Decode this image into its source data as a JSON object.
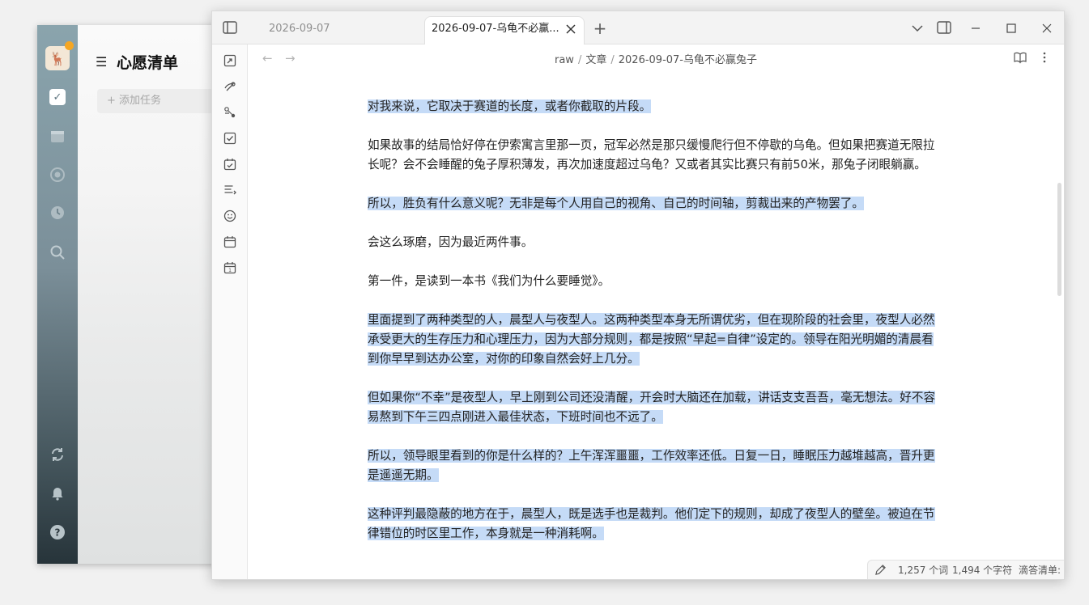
{
  "background_app": {
    "title": "心愿清单",
    "add_task_placeholder": "添加任务",
    "icons": [
      "avatar-icon",
      "task-check-icon",
      "calendar-icon",
      "focus-icon",
      "clock-icon",
      "search-icon",
      "sync-icon",
      "bell-icon",
      "help-icon"
    ]
  },
  "window": {
    "tabs": [
      {
        "label": "2026-09-07",
        "active": false
      },
      {
        "label": "2026-09-07-乌龟不必赢...",
        "active": true,
        "pinned": true
      }
    ],
    "new_tab_label": "+"
  },
  "breadcrumb": {
    "parts": [
      "raw",
      "文章",
      "2026-09-07-乌龟不必赢兔子"
    ],
    "separator": "/"
  },
  "document": {
    "paragraphs": [
      {
        "text": "对我来说，它取决于赛道的长度，或者你截取的片段。",
        "highlighted": true
      },
      {
        "text": "如果故事的结局恰好停在伊索寓言里那一页，冠军必然是那只缓慢爬行但不停歇的乌龟。但如果把赛道无限拉长呢？会不会睡醒的兔子厚积薄发，再次加速度超过乌龟？又或者其实比赛只有前50米，那兔子闭眼躺赢。",
        "highlighted": false
      },
      {
        "text": "所以，胜负有什么意义呢？无非是每个人用自己的视角、自己的时间轴，剪裁出来的产物罢了。",
        "highlighted": true
      },
      {
        "text": "会这么琢磨，因为最近两件事。",
        "highlighted": false
      },
      {
        "text": "第一件，是读到一本书《我们为什么要睡觉》。",
        "highlighted": false
      },
      {
        "text": "里面提到了两种类型的人，晨型人与夜型人。这两种类型本身无所谓优劣，但在现阶段的社会里，夜型人必然承受更大的生存压力和心理压力，因为大部分规则，都是按照“早起=自律”设定的。领导在阳光明媚的清晨看到你早早到达办公室，对你的印象自然会好上几分。",
        "highlighted": true
      },
      {
        "text": "但如果你“不幸”是夜型人，早上刚到公司还没清醒，开会时大脑还在加载，讲话支支吾吾，毫无想法。好不容易熬到下午三四点刚进入最佳状态，下班时间也不远了。",
        "highlighted": true
      },
      {
        "text": "所以，领导眼里看到的你是什么样的？上午浑浑噩噩，工作效率还低。日复一日，睡眠压力越堆越高，晋升更是遥遥无期。",
        "highlighted": true
      },
      {
        "text": "这种评判最隐蔽的地方在于，晨型人，既是选手也是裁判。他们定下的规则，却成了夜型人的壁垒。被迫在节律错位的时区里工作，本身就是一种消耗啊。",
        "highlighted": true
      }
    ]
  },
  "status_bar": {
    "words": "1,257 个词",
    "chars": "1,494 个字符",
    "plugin": "滴答清单: 已连接"
  },
  "colors": {
    "highlight": "#c5dbf7",
    "accent": "#3b82f6",
    "rail_top": "#8aa4ad",
    "rail_bottom": "#27343a"
  }
}
